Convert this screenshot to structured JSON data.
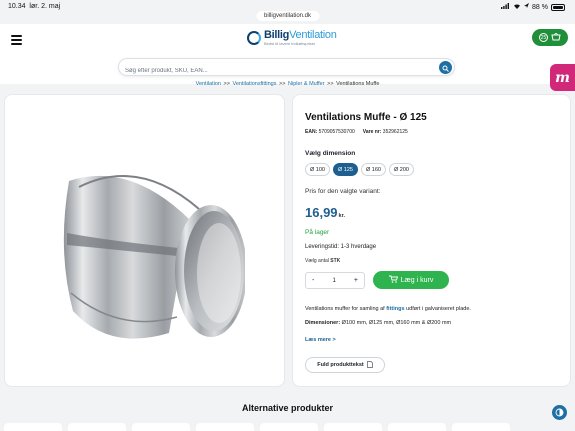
{
  "status_bar": {
    "time": "10.34",
    "date": "lør. 2. maj",
    "battery": "88 %"
  },
  "browser": {
    "url": "billigventilation.dk"
  },
  "header": {
    "logo_name_part1": "Billig",
    "logo_name_part2": "Ventilation",
    "logo_tagline": "Bedst til lavere indkøbspriser",
    "cart_count": "25"
  },
  "search": {
    "placeholder": "Søg efter produkt, SKU, EAN..."
  },
  "breadcrumb": {
    "items": [
      "Ventilation",
      "Ventilationsfittings",
      "Nipler & Muffer",
      "Ventilations Muffe"
    ],
    "separator": ">>"
  },
  "side_tab": {
    "letter": "m"
  },
  "product": {
    "title": "Ventilations Muffe - Ø 125",
    "ean_label": "EAN:",
    "ean": "5709057530700",
    "vare_label": "Vare nr:",
    "vare": "352962125",
    "dimension_label": "Vælg dimension",
    "dimensions": [
      "Ø 100",
      "Ø 125",
      "Ø 160",
      "Ø 200"
    ],
    "selected_dimension": "Ø 125",
    "price_label": "Pris for den valgte variant:",
    "price": "16,99",
    "price_unit": "kr.",
    "stock": "På lager",
    "delivery": "Leveringstid: 1-3 hverdage",
    "qty_label": "Vælg antal",
    "qty_unit": "STK",
    "qty_minus": "-",
    "quantity": "1",
    "qty_plus": "+",
    "add_to_cart": "Læg i kurv",
    "desc_before": "Ventilations muffer for samling af ",
    "desc_link": "fittings",
    "desc_after": " udført i galvaniseret plade.",
    "dims_label": "Dimensioner:",
    "dims_value": " Ø100 mm, Ø125 mm, Ø160 mm & Ø200 mm",
    "read_more": "Læs mere >",
    "full_text_button": "Fuld produkttekst"
  },
  "alternatives": {
    "title": "Alternative produkter"
  },
  "colors": {
    "brand_blue": "#1d5f8f",
    "green": "#2eb34f",
    "magenta": "#d1287a"
  }
}
